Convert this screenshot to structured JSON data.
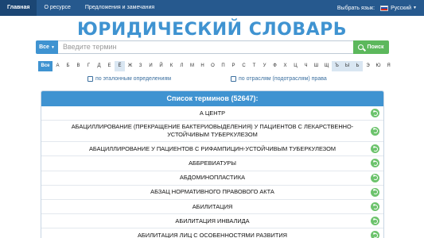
{
  "nav": {
    "items": [
      {
        "label": "Главная",
        "active": true
      },
      {
        "label": "О ресурсе",
        "active": false
      },
      {
        "label": "Предложения и замечания",
        "active": false
      }
    ],
    "language_label": "Выбрать язык:",
    "language_value": "Русский",
    "flag_colors": [
      "#ffffff",
      "#1c4fb0",
      "#d52b1e"
    ]
  },
  "title": "ЮРИДИЧЕСКИЙ СЛОВАРЬ",
  "search": {
    "scope_label": "Все",
    "placeholder": "Введите термин",
    "button_label": "Поиск"
  },
  "alphabet": {
    "all_label": "Все",
    "letters": [
      "А",
      "Б",
      "В",
      "Г",
      "Д",
      "Е",
      "Ё",
      "Ж",
      "З",
      "И",
      "Й",
      "К",
      "Л",
      "М",
      "Н",
      "О",
      "П",
      "Р",
      "С",
      "Т",
      "У",
      "Ф",
      "Х",
      "Ц",
      "Ч",
      "Ш",
      "Щ",
      "Ъ",
      "Ы",
      "Ь",
      "Э",
      "Ю",
      "Я"
    ],
    "highlighted": [
      "Ё",
      "Ъ",
      "Ы",
      "Ь"
    ]
  },
  "filters": {
    "reference_label": "по эталонным определениям",
    "branches_label": "по отраслям (подотраслям) права"
  },
  "list": {
    "header": "Список терминов (52647):",
    "terms": [
      {
        "label": "А ЦЕНТР",
        "tall": false
      },
      {
        "label": "АБАЦИЛЛИРОВАНИЕ (ПРЕКРАЩЕНИЕ БАКТЕРИОВЫДЕЛЕНИЯ) У ПАЦИЕНТОВ С ЛЕКАРСТВЕННО-УСТОЙЧИВЫМ ТУБЕРКУЛЕЗОМ",
        "tall": true
      },
      {
        "label": "АБАЦИЛЛИРОВАНИЕ У ПАЦИЕНТОВ С РИФАМПИЦИН-УСТОЙЧИВЫМ ТУБЕРКУЛЕЗОМ",
        "tall": false
      },
      {
        "label": "АББРЕВИАТУРЫ",
        "tall": false
      },
      {
        "label": "АБДОМИНОПЛАСТИКА",
        "tall": false
      },
      {
        "label": "АБЗАЦ НОРМАТИВНОГО ПРАВОВОГО АКТА",
        "tall": false
      },
      {
        "label": "АБИЛИТАЦИЯ",
        "tall": false
      },
      {
        "label": "АБИЛИТАЦИЯ ИНВАЛИДА",
        "tall": false
      },
      {
        "label": "АБИЛИТАЦИЯ ЛИЦ С ОСОБЕННОСТЯМИ РАЗВИТИЯ",
        "tall": false
      }
    ]
  },
  "colors": {
    "navbar": "#26598e",
    "accent_blue": "#3f93d1",
    "search_green": "#5cb85c",
    "row_icon_green": "#6cc36c"
  }
}
